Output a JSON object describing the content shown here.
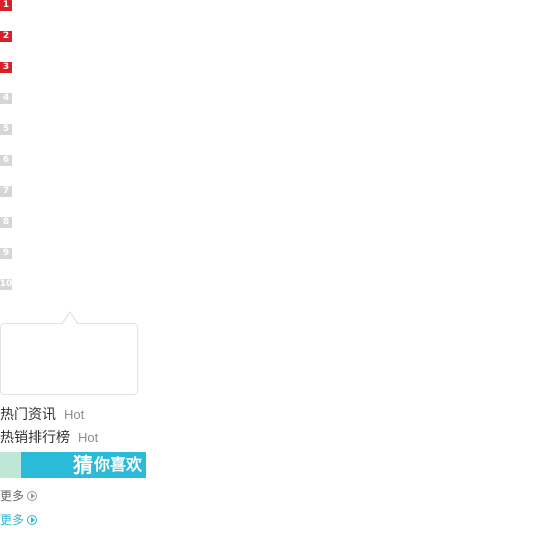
{
  "rank_list": {
    "items": [
      {
        "rank": "1",
        "style": "top"
      },
      {
        "rank": "2",
        "style": "top"
      },
      {
        "rank": "3",
        "style": "top"
      },
      {
        "rank": "4",
        "style": "low"
      },
      {
        "rank": "5",
        "style": "low"
      },
      {
        "rank": "6",
        "style": "low"
      },
      {
        "rank": "7",
        "style": "low"
      },
      {
        "rank": "8",
        "style": "low"
      },
      {
        "rank": "9",
        "style": "low"
      },
      {
        "rank": "10",
        "style": "low"
      }
    ]
  },
  "hot_news": {
    "label": "热门资讯",
    "tag": "Hot"
  },
  "best_sellers": {
    "label": "热销排行榜",
    "tag": "Hot"
  },
  "guess_banner": {
    "big_char": "猜",
    "rest": "你喜欢"
  },
  "more_gray": {
    "label": "更多"
  },
  "more_blue": {
    "label": "更多"
  },
  "colors": {
    "rank_top": "#d6212a",
    "rank_low": "#d6d6d6",
    "accent_blue": "#2bbad8",
    "banner_left": "#bfe7d7"
  }
}
